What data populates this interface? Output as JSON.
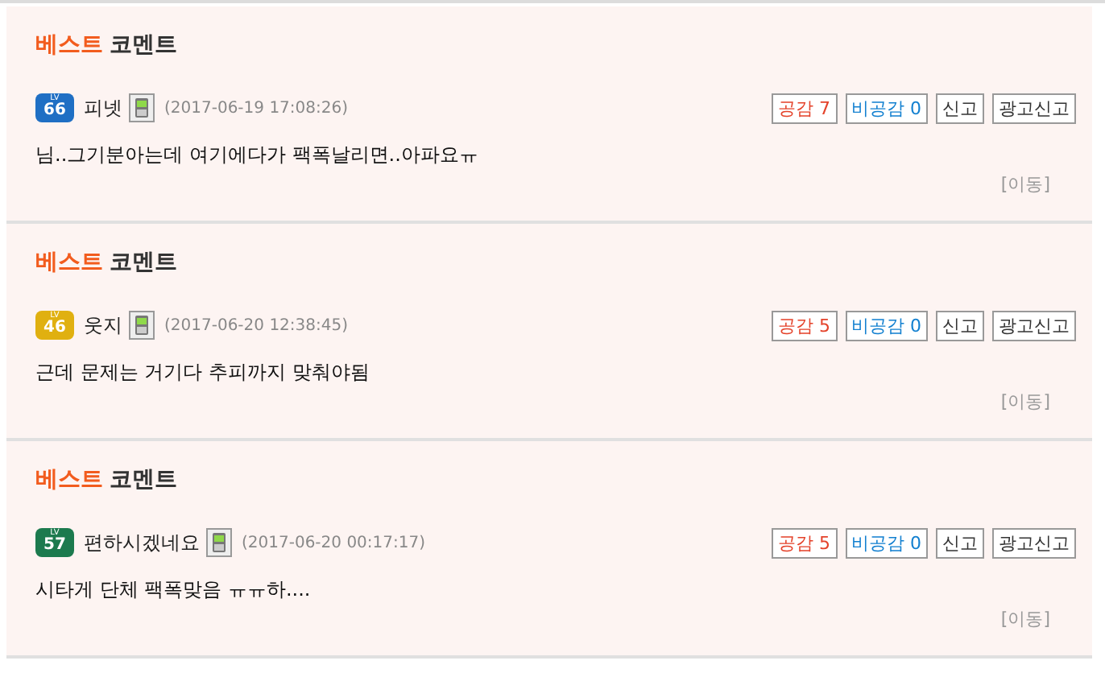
{
  "comments": [
    {
      "heading_best": "베스트",
      "heading_rest": "코멘트",
      "level_label": "LV",
      "level": "66",
      "color": "#1f6fc4",
      "user": "피넷",
      "time": "(2017-06-19 17:08:26)",
      "buttons": [
        {
          "label": "공감 7",
          "kind": "like"
        },
        {
          "label": "비공감 0",
          "kind": "dislike"
        },
        {
          "label": "신고",
          "kind": "plain"
        },
        {
          "label": "광고신고",
          "kind": "plain"
        }
      ],
      "text": "님..그기분아는데 여기에다가 팩폭날리면..아파요ㅠ",
      "move": "[이동]"
    },
    {
      "heading_best": "베스트",
      "heading_rest": "코멘트",
      "level_label": "LV",
      "level": "46",
      "color": "#e0b010",
      "user": "웃지",
      "time": "(2017-06-20 12:38:45)",
      "buttons": [
        {
          "label": "공감 5",
          "kind": "like"
        },
        {
          "label": "비공감 0",
          "kind": "dislike"
        },
        {
          "label": "신고",
          "kind": "plain"
        },
        {
          "label": "광고신고",
          "kind": "plain"
        }
      ],
      "text": "근데 문제는 거기다 추피까지 맞춰야됨",
      "move": "[이동]"
    },
    {
      "heading_best": "베스트",
      "heading_rest": "코멘트",
      "level_label": "LV",
      "level": "57",
      "color": "#1c7a4e",
      "user": "편하시겠네요",
      "time": "(2017-06-20 00:17:17)",
      "buttons": [
        {
          "label": "공감 5",
          "kind": "like"
        },
        {
          "label": "비공감 0",
          "kind": "dislike"
        },
        {
          "label": "신고",
          "kind": "plain"
        },
        {
          "label": "광고신고",
          "kind": "plain"
        }
      ],
      "text": "시타게 단체 팩폭맞음 ㅠㅠ하....",
      "move": "[이동]"
    }
  ]
}
